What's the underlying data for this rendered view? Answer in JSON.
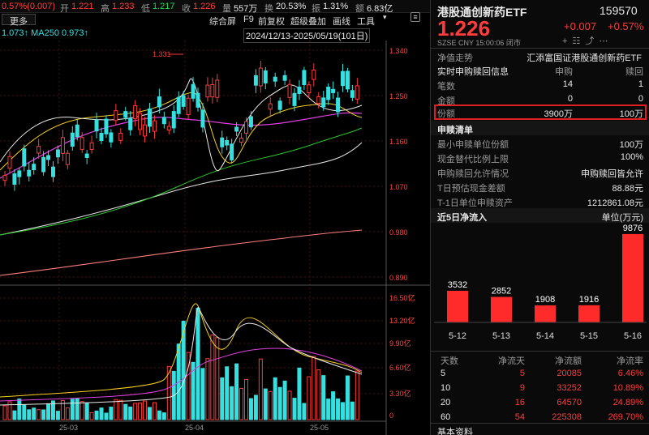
{
  "topbar": {
    "pct_change": "0.57%(0.007)",
    "open_label": "开",
    "open": "1.221",
    "high_label": "高",
    "high": "1.233",
    "low_label": "低",
    "low": "1.217",
    "close_label": "收",
    "close": "1.226",
    "volume_label": "量",
    "volume": "557万",
    "turnover_label": "换",
    "turnover": "20.53%",
    "amplitude_label": "振",
    "amplitude": "1.31%",
    "amount_label": "额",
    "amount": "6.83亿"
  },
  "menu": {
    "more": "更多",
    "ma_values": "1.073↑  MA250  0.973↑",
    "items": [
      "综合屏",
      "F9",
      "前复权",
      "超级叠加",
      "画线",
      "工具"
    ],
    "date_range": "2024/12/13-2025/05/19(101日)"
  },
  "kline": {
    "y_ticks": [
      "1.340",
      "1.250",
      "1.160",
      "1.070",
      "0.980",
      "0.890"
    ],
    "max_marker": "1.331",
    "vol_ticks": [
      "16.50亿",
      "13.20亿",
      "9.90亿",
      "6.60亿",
      "3.30亿",
      "0"
    ],
    "x_ticks": [
      "25-03",
      "25-04",
      "25-05"
    ]
  },
  "quote": {
    "name": "港股通创新药ETF",
    "code": "159570",
    "price": "1.226",
    "change": "+0.007",
    "change_pct": "+0.57%",
    "meta": "SZSE  CNY  15:00:06  闭市",
    "colors": {
      "up": "#ff3b3b",
      "down": "#1ed760",
      "accent": "#34e0e0",
      "highlight_box": "#e02020"
    }
  },
  "nav": {
    "label": "净值走势",
    "fund_company": "汇添富国证港股通创新药ETF"
  },
  "realtime": {
    "title": "实时申购赎回信息",
    "col1": "申购",
    "col2": "赎回",
    "rows": [
      {
        "label": "笔数",
        "v1": "14",
        "v2": "1"
      },
      {
        "label": "金额",
        "v1": "0",
        "v2": "0"
      },
      {
        "label": "份额",
        "v1": "3900万",
        "v2": "100万"
      }
    ]
  },
  "list": {
    "title": "申赎清单",
    "rows": [
      {
        "label": "最小申赎单位份额",
        "value": "100万"
      },
      {
        "label": "现金替代比例上限",
        "value": "100%"
      },
      {
        "label": "申购赎回允许情况",
        "value": "申购赎回皆允许"
      },
      {
        "label": "T日预估现金差额",
        "value": "88.88元"
      },
      {
        "label": "T-1日单位申赎资产",
        "value": "1212861.08元"
      }
    ]
  },
  "flow5": {
    "title": "近5日净流入",
    "unit": "单位(万元)",
    "chart_data": {
      "type": "bar",
      "categories": [
        "5-12",
        "5-13",
        "5-14",
        "5-15",
        "5-16"
      ],
      "values": [
        3532,
        2852,
        1908,
        1916,
        9876
      ],
      "ylim": [
        0,
        10500
      ]
    }
  },
  "flowtable": {
    "headers": [
      "天数",
      "净流天",
      "净流额",
      "净流率"
    ],
    "rows": [
      [
        "5",
        "5",
        "20085",
        "6.46%"
      ],
      [
        "10",
        "9",
        "33252",
        "10.89%"
      ],
      [
        "20",
        "16",
        "64570",
        "24.89%"
      ],
      [
        "60",
        "54",
        "225308",
        "269.70%"
      ]
    ],
    "footer": "基本资料"
  }
}
